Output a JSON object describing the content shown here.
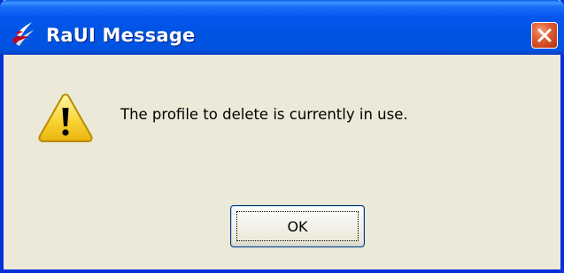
{
  "window": {
    "title": "RaUI Message",
    "app_icon": "raui-app-icon",
    "close_icon": "close-icon"
  },
  "dialog": {
    "icon": "warning-icon",
    "message": "The profile to delete is currently in use.",
    "ok_label": "OK"
  },
  "colors": {
    "titlebar": "#0054e3",
    "frame": "#0831d9",
    "body": "#ece9d8",
    "close_button": "#e3633b",
    "warning": "#f9d536"
  }
}
